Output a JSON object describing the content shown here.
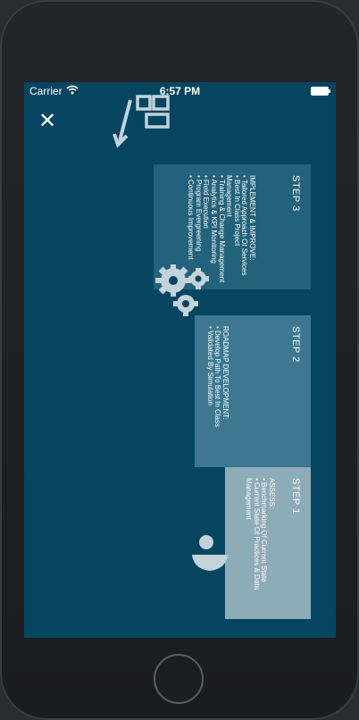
{
  "status_bar": {
    "carrier": "Carrier",
    "time": "6:57 PM",
    "wifi_icon": "wifi-icon",
    "battery_icon": "battery-icon"
  },
  "close_button": {
    "icon": "close-icon",
    "label": "✕"
  },
  "colors": {
    "screen_bg": "#05455f",
    "step3_box": "#23627b",
    "step2_box": "#3d7790",
    "step1_box": "#8eabb8",
    "illustration": "#c2d3da"
  },
  "steps": [
    {
      "label": "STEP 1",
      "heading": "ASSESS:",
      "items": [
        "Benchmarking Of Current State",
        "Current State Of Practices & Data Management"
      ],
      "icon": "person-icon"
    },
    {
      "label": "STEP 2",
      "heading": "ROADMAP DEVELOPMENT:",
      "items": [
        "Develop Path To Best In Class",
        "Validated By Simulation"
      ],
      "icon": "gears-icon"
    },
    {
      "label": "STEP 3",
      "heading": "IMPLEMENT & IMPROVE:",
      "items": [
        "Tailored Approach Of Services",
        "Best In Class Project Management",
        "Training & Change Management",
        "Analytics & KPI Monitoring",
        "Field Execution",
        "Program Evergreening",
        "Continuous Improvement"
      ],
      "icon": "growth-chart-icon"
    }
  ]
}
